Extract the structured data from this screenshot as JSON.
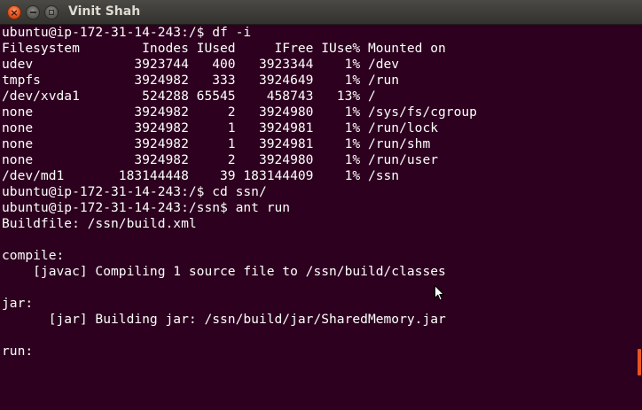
{
  "window": {
    "title": "Vinit Shah",
    "close_glyph": "×",
    "minimize_icon": "minimize-icon",
    "maximize_icon": "maximize-icon"
  },
  "terminal": {
    "lines": [
      "ubuntu@ip-172-31-14-243:/$ df -i",
      "Filesystem        Inodes IUsed     IFree IUse% Mounted on",
      "udev             3923744   400   3923344    1% /dev",
      "tmpfs            3924982   333   3924649    1% /run",
      "/dev/xvda1        524288 65545    458743   13% /",
      "none             3924982     2   3924980    1% /sys/fs/cgroup",
      "none             3924982     1   3924981    1% /run/lock",
      "none             3924982     1   3924981    1% /run/shm",
      "none             3924982     2   3924980    1% /run/user",
      "/dev/md1       183144448    39 183144409    1% /ssn",
      "ubuntu@ip-172-31-14-243:/$ cd ssn/",
      "ubuntu@ip-172-31-14-243:/ssn$ ant run",
      "Buildfile: /ssn/build.xml",
      "",
      "compile:",
      "    [javac] Compiling 1 source file to /ssn/build/classes",
      "",
      "jar:",
      "      [jar] Building jar: /ssn/build/jar/SharedMemory.jar",
      "",
      "run:"
    ]
  },
  "colors": {
    "terminal_background": "#2c001e",
    "terminal_text": "#ffffff",
    "titlebar": "#3c3b37",
    "close_button": "#e2531f",
    "scrollbar_thumb": "#e95420"
  },
  "icons": {
    "cursor": "mouse-pointer-icon"
  }
}
